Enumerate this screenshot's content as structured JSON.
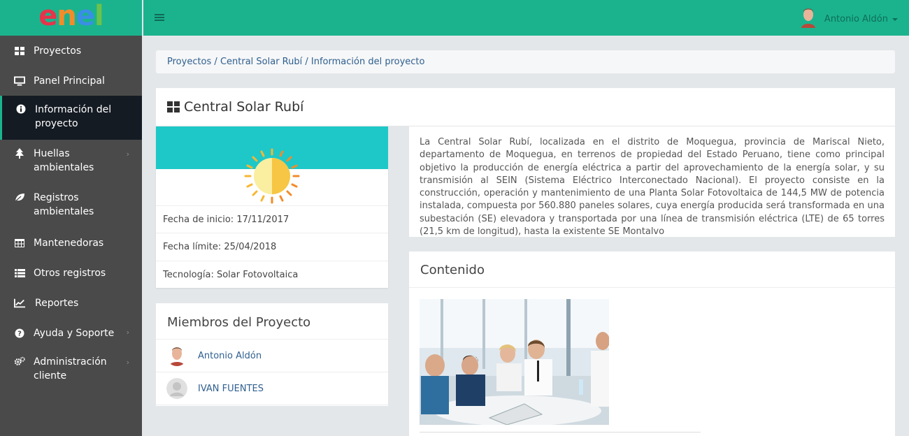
{
  "brand": {
    "logo_letters": [
      "e",
      "n",
      "e",
      "l"
    ],
    "colors": {
      "primary": "#1bb38e",
      "sidebar": "#4a4a4a",
      "sidebar_active": "#151b23",
      "link": "#2f5f8f",
      "banner": "#1ec8c8"
    }
  },
  "sidebar": {
    "items": [
      {
        "label": "Proyectos",
        "icon": "grid-icon"
      },
      {
        "label": "Panel Principal",
        "icon": "monitor-icon"
      },
      {
        "label": "Información del proyecto",
        "icon": "info-icon",
        "active": true
      },
      {
        "label": "Huellas ambientales",
        "icon": "tree-icon"
      },
      {
        "label": "Registros ambientales",
        "icon": "leaf-icon"
      },
      {
        "label": "Mantenedoras",
        "icon": "table-icon"
      },
      {
        "label": "Otros registros",
        "icon": "list-icon"
      },
      {
        "label": "Reportes",
        "icon": "chart-line-icon"
      },
      {
        "label": "Ayuda y Soporte",
        "icon": "question-icon"
      },
      {
        "label": "Administración cliente",
        "icon": "cogs-icon"
      }
    ]
  },
  "topbar": {
    "user_name": "Antonio Aldón"
  },
  "breadcrumb": {
    "items": [
      "Proyectos",
      "Central Solar Rubí",
      "Información del proyecto"
    ],
    "separator": " / "
  },
  "project": {
    "title": "Central Solar Rubí",
    "start_date": "Fecha de inicio: 17/11/2017",
    "end_date": "Fecha límite: 25/04/2018",
    "technology": "Tecnología: Solar Fotovoltaica",
    "description": "La Central Solar Rubí, localizada en el distrito de Moquegua, provincia de Mariscal Nieto, departamento de Moquegua, en terrenos de propiedad del Estado Peruano, tiene como principal objetivo la producción de energía eléctrica a partir del aprovechamiento de la energía solar, y su transmisión al SEIN (Sistema Eléctrico Interconectado Nacional). El proyecto consiste en la construcción, operación y mantenimiento de una Planta Solar Fotovoltaica de 144,5 MW de potencia instalada, compuesta por 560.880 paneles solares, cuya energía producida será transformada en una subestación (SE) elevadora y transportada por una línea de transmisión eléctrica (LTE) de 65 torres (21,5 km de longitud), hasta la existente SE Montalvo"
  },
  "members": {
    "title": "Miembros del Proyecto",
    "list": [
      {
        "name": "Antonio Aldón"
      },
      {
        "name": "IVAN FUENTES"
      }
    ]
  },
  "content": {
    "title": "Contenido"
  }
}
